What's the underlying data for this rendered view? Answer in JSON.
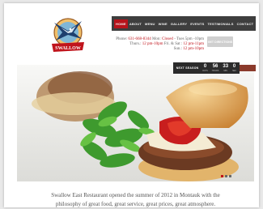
{
  "brand": {
    "logo_text": "SWALLOW"
  },
  "nav": {
    "items": [
      {
        "label": "HOME",
        "active": true
      },
      {
        "label": "ABOUT",
        "active": false
      },
      {
        "label": "MENU",
        "active": false
      },
      {
        "label": "WINE",
        "active": false
      },
      {
        "label": "GALLERY",
        "active": false
      },
      {
        "label": "EVENTS",
        "active": false
      },
      {
        "label": "TESTIMONIALS",
        "active": false
      },
      {
        "label": "CONTACT",
        "active": false
      }
    ]
  },
  "info": {
    "phone_label": "Phone:",
    "phone": "631-668-8344",
    "mon_label": "Mon:",
    "mon_value": "Closed",
    "tue_wed": "- Tues 5pm -10pm",
    "thurs_label": "Thurs.:",
    "thurs_value": "12 pm-10pm",
    "fri_sat": "Fri. & Sat :",
    "fri_sat_value": "12 pm-11pm",
    "sun_label": "Sun.:",
    "sun_value": "12 pm-10pm"
  },
  "buttons": {
    "get_directions": "GET DIRECTIONS"
  },
  "countdown": {
    "label": "NEXT SEASON",
    "units": [
      {
        "num": "0",
        "cap": "DAYS"
      },
      {
        "num": "56",
        "cap": "HOURS"
      },
      {
        "num": "33",
        "cap": "MIN"
      },
      {
        "num": "0",
        "cap": "SEC"
      }
    ]
  },
  "slider": {
    "dot_count": 3,
    "active_index": 0
  },
  "intro": {
    "line1": "Swallow East Restaurant opened the summer of 2012 in Montauk with the",
    "line2": "philosophy of great food, great service, great prices, great atmosphere."
  },
  "colors": {
    "accent": "#c0141c",
    "nav_bg": "#3e3e3e"
  }
}
